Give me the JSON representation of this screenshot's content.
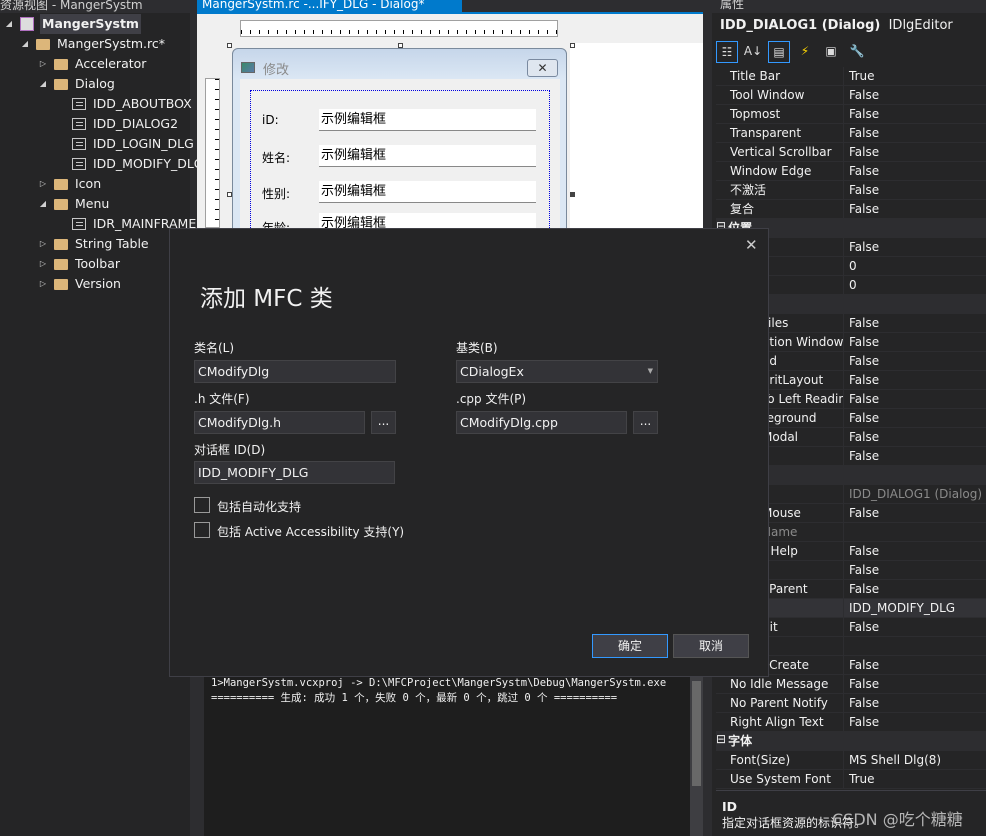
{
  "resource_view": {
    "title": "资源视图 - MangerSystm",
    "items": [
      {
        "label": "MangerSystm",
        "type": "project"
      },
      {
        "label": "MangerSystm.rc*",
        "type": "folder-open"
      },
      {
        "label": "Accelerator",
        "type": "folder"
      },
      {
        "label": "Dialog",
        "type": "folder-open"
      },
      {
        "label": "IDD_ABOUTBOX",
        "type": "dialog"
      },
      {
        "label": "IDD_DIALOG2",
        "type": "dialog"
      },
      {
        "label": "IDD_LOGIN_DLG",
        "type": "dialog"
      },
      {
        "label": "IDD_MODIFY_DLG",
        "type": "dialog"
      },
      {
        "label": "Icon",
        "type": "folder"
      },
      {
        "label": "Menu",
        "type": "folder-open"
      },
      {
        "label": "IDR_MAINFRAME",
        "type": "menu"
      },
      {
        "label": "String Table",
        "type": "folder"
      },
      {
        "label": "Toolbar",
        "type": "folder"
      },
      {
        "label": "Version",
        "type": "folder"
      }
    ]
  },
  "editor": {
    "tab_label": "MangerSystm.rc -...IFY_DLG - Dialog*",
    "preview": {
      "title": "修改",
      "fields": [
        {
          "label": "iD:",
          "value": "示例编辑框"
        },
        {
          "label": "姓名:",
          "value": "示例编辑框"
        },
        {
          "label": "性别:",
          "value": "示例编辑框"
        },
        {
          "label": "年龄:",
          "value": "示例编辑框"
        }
      ]
    }
  },
  "output": {
    "lines": [
      "1>MangerSystm.vcxproj -> D:\\MFCProject\\MangerSystm\\Debug\\MangerSystm.exe",
      "========== 生成: 成功 1 个，失败 0 个，最新 0 个，跳过 0 个 =========="
    ]
  },
  "properties": {
    "title": "属性",
    "object": "IDD_DIALOG1 (Dialog)",
    "editor": "IDlgEditor",
    "rows": [
      {
        "name": "Title Bar",
        "value": "True"
      },
      {
        "name": "Tool Window",
        "value": "False"
      },
      {
        "name": "Topmost",
        "value": "False"
      },
      {
        "name": "Transparent",
        "value": "False"
      },
      {
        "name": "Vertical Scrollbar",
        "value": "False"
      },
      {
        "name": "Window Edge",
        "value": "False"
      },
      {
        "name": "不激活",
        "value": "False"
      },
      {
        "name": "复合",
        "value": "False"
      },
      {
        "name": "位置",
        "value": "",
        "section": true
      },
      {
        "name": "",
        "value": "False"
      },
      {
        "name": "",
        "value": "0"
      },
      {
        "name": "",
        "value": "0"
      },
      {
        "name": "",
        "value": "",
        "section": true
      },
      {
        "name": "Files",
        "value": "False",
        "partial": true
      },
      {
        "name": "ation Window",
        "value": "False",
        "partial": true
      },
      {
        "name": "ed",
        "value": "False",
        "partial": true
      },
      {
        "name": "eritLayout",
        "value": "False",
        "partial": true
      },
      {
        "name": "To Left Reading",
        "value": "False",
        "partial": true
      },
      {
        "name": "reground",
        "value": "False",
        "partial": true
      },
      {
        "name": "Modal",
        "value": "False",
        "partial": true
      },
      {
        "name": "",
        "value": "False"
      },
      {
        "name": "",
        "value": "",
        "section": true
      },
      {
        "name": ")",
        "value": "IDD_DIALOG1 (Dialog)",
        "partial": true,
        "gray": true
      },
      {
        "name": "Mouse",
        "value": "False",
        "partial": true
      },
      {
        "name": "Name",
        "value": "",
        "partial": true,
        "gray": true
      },
      {
        "name": "t Help",
        "value": "False",
        "partial": true
      },
      {
        "name": "l",
        "value": "False",
        "partial": true
      },
      {
        "name": "l Parent",
        "value": "False",
        "partial": true
      },
      {
        "name": "",
        "value": "IDD_MODIFY_DLG",
        "highlight": true
      },
      {
        "name": "dit",
        "value": "False",
        "partial": true
      },
      {
        "name": "",
        "value": ""
      },
      {
        "name": "l Create",
        "value": "False",
        "partial": true
      },
      {
        "name": "No Idle Message",
        "value": "False"
      },
      {
        "name": "No Parent Notify",
        "value": "False"
      },
      {
        "name": "Right Align Text",
        "value": "False"
      },
      {
        "name": "字体",
        "value": "",
        "section": true
      },
      {
        "name": "Font(Size)",
        "value": "MS Shell Dlg(8)"
      },
      {
        "name": "Use System Font",
        "value": "True"
      }
    ],
    "description_title": "ID",
    "description": "指定对话框资源的标识符。"
  },
  "modal": {
    "title": "添加 MFC 类",
    "class_name_label": "类名(L)",
    "class_name": "CModifyDlg",
    "base_class_label": "基类(B)",
    "base_class": "CDialogEx",
    "h_file_label": ".h 文件(F)",
    "h_file": "CModifyDlg.h",
    "cpp_file_label": ".cpp 文件(P)",
    "cpp_file": "CModifyDlg.cpp",
    "browse_label": "...",
    "dialog_id_label": "对话框 ID(D)",
    "dialog_id": "IDD_MODIFY_DLG",
    "automation_label": "包括自动化支持",
    "automation_checked": false,
    "accessibility_label": "包括 Active Accessibility 支持(Y)",
    "accessibility_checked": false,
    "ok_label": "确定",
    "cancel_label": "取消"
  },
  "watermark": "CSDN @吃个糖糖"
}
